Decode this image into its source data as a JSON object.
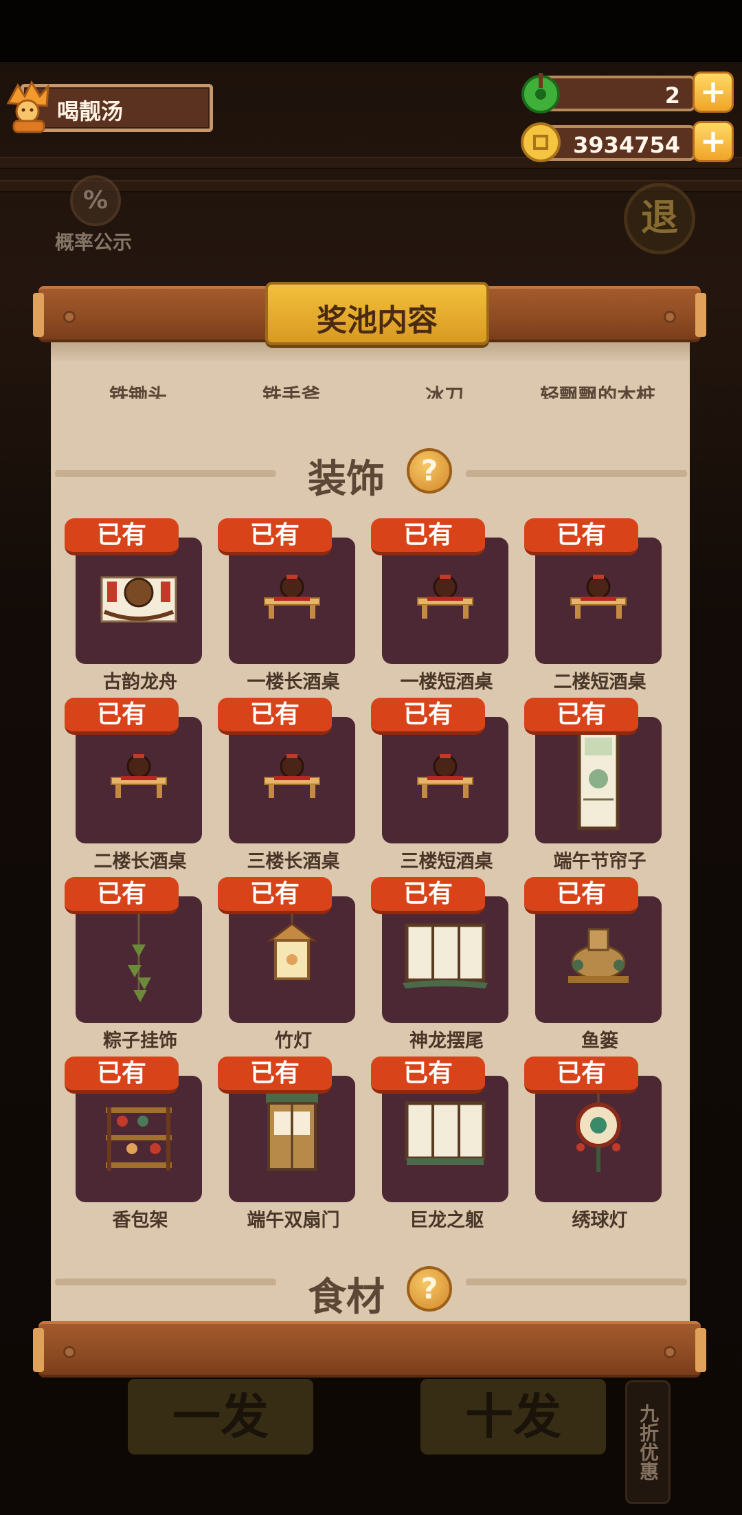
{
  "player": {
    "name": "喝靓汤"
  },
  "resources": {
    "jade": "2",
    "coins": "3934754",
    "plus": "+"
  },
  "sidebar": {
    "prob_symbol": "%",
    "prob_label": "概率公示",
    "exit_label": "退"
  },
  "bottom": {
    "single_draw": "一发",
    "ten_draw": "十发",
    "discount": "九折优惠"
  },
  "panel": {
    "title": "奖池内容",
    "cut_row": [
      "铁锄头",
      "铁手斧",
      "冰刀",
      "轻飘飘的木桩"
    ],
    "section_title": "装饰",
    "help_symbol": "?",
    "next_section_partial": "食材",
    "owned_label": "已有",
    "items": [
      {
        "name": "古韵龙舟",
        "icon": "dragon-boat-icon"
      },
      {
        "name": "一楼长酒桌",
        "icon": "wine-table-icon"
      },
      {
        "name": "一楼短酒桌",
        "icon": "wine-table-icon"
      },
      {
        "name": "二楼短酒桌",
        "icon": "wine-table-icon"
      },
      {
        "name": "二楼长酒桌",
        "icon": "wine-table-icon"
      },
      {
        "name": "三楼长酒桌",
        "icon": "wine-table-icon"
      },
      {
        "name": "三楼短酒桌",
        "icon": "wine-table-icon"
      },
      {
        "name": "端午节帘子",
        "icon": "curtain-icon"
      },
      {
        "name": "粽子挂饰",
        "icon": "zongzi-ornament-icon"
      },
      {
        "name": "竹灯",
        "icon": "bamboo-lamp-icon"
      },
      {
        "name": "神龙摆尾",
        "icon": "dragon-tail-window-icon"
      },
      {
        "name": "鱼篓",
        "icon": "fish-basket-icon"
      },
      {
        "name": "香包架",
        "icon": "sachet-rack-icon"
      },
      {
        "name": "端午双扇门",
        "icon": "double-door-icon"
      },
      {
        "name": "巨龙之躯",
        "icon": "dragon-body-window-icon"
      },
      {
        "name": "绣球灯",
        "icon": "embroidered-ball-lamp-icon"
      }
    ]
  }
}
